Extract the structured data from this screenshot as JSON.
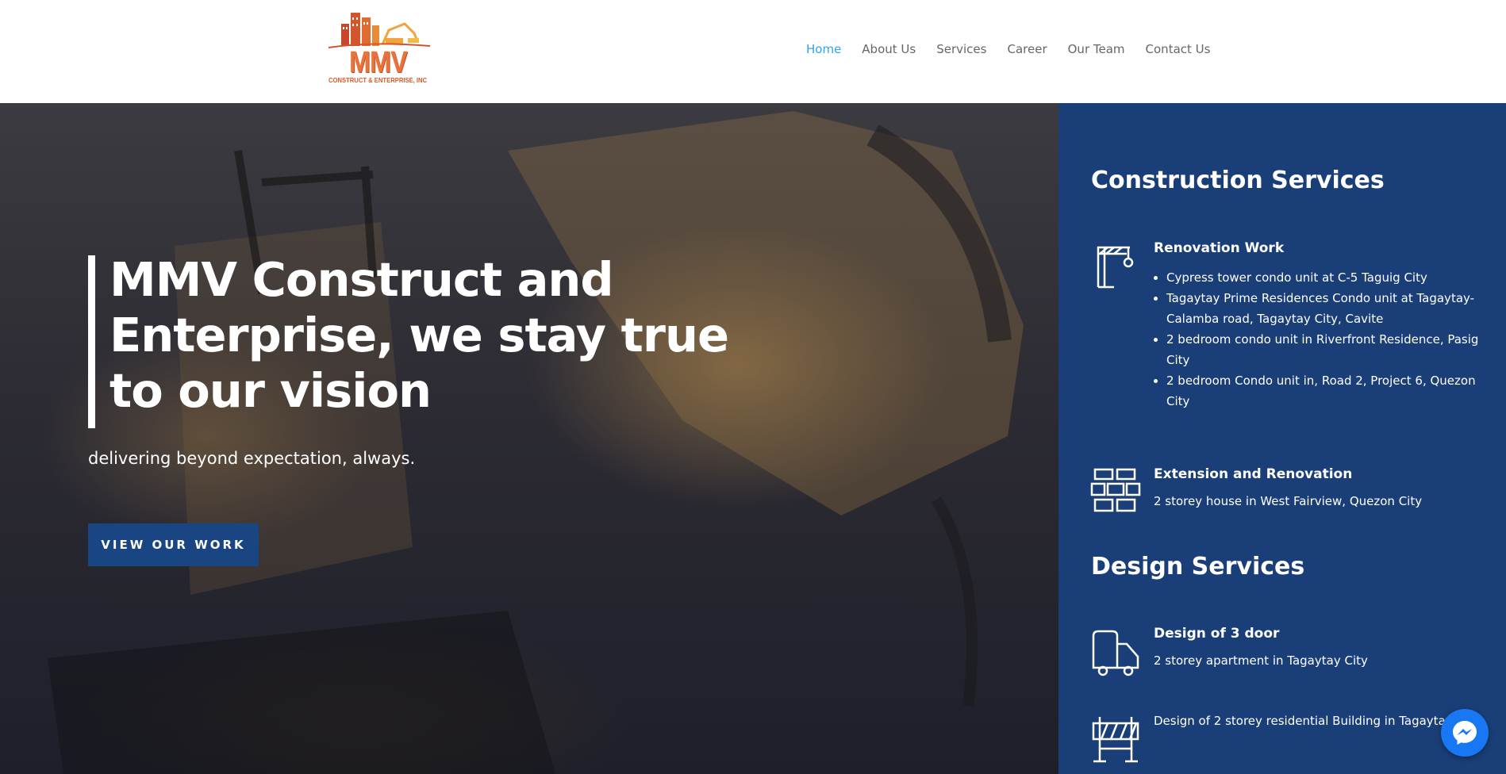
{
  "brand": {
    "logo_text": "MMV",
    "logo_subtext": "CONSTRUCT & ENTERPRISE, INC"
  },
  "nav": {
    "items": [
      {
        "label": "Home",
        "active": true
      },
      {
        "label": "About Us",
        "active": false
      },
      {
        "label": "Services",
        "active": false
      },
      {
        "label": "Career",
        "active": false
      },
      {
        "label": "Our Team",
        "active": false
      },
      {
        "label": "Contact Us",
        "active": false
      }
    ]
  },
  "hero": {
    "title": "MMV Construct and Enterprise, we stay true to our vision",
    "subtitle": "delivering beyond expectation, always.",
    "button_label": "VIEW OUR WORK"
  },
  "sidebar": {
    "construction_heading": "Construction Services",
    "design_heading": "Design Services",
    "renovation": {
      "icon": "crane-icon",
      "title": "Renovation Work",
      "items": [
        "Cypress tower condo unit at C-5 Taguig City",
        "Tagaytay Prime Residences Condo unit at Tagaytay-Calamba road, Tagaytay City, Cavite",
        "2 bedroom condo unit in Riverfront Residence, Pasig City",
        "2 bedroom Condo unit in, Road 2, Project 6, Quezon City"
      ]
    },
    "extension": {
      "icon": "bricks-icon",
      "title": "Extension and Renovation",
      "text": "2 storey house in West Fairview, Quezon City"
    },
    "design1": {
      "icon": "truck-icon",
      "title": "Design of 3 door",
      "text": "2 storey apartment in Tagaytay City"
    },
    "design2": {
      "icon": "barrier-icon",
      "text": "Design of 2 storey residential Building in Tagaytay City"
    }
  },
  "colors": {
    "nav_active": "#2ea3f2",
    "sidebar_bg": "#1a3f78",
    "button_bg": "#1a4583",
    "logo_orange": "#e9733b"
  },
  "widgets": {
    "messenger_icon": "messenger-icon"
  }
}
